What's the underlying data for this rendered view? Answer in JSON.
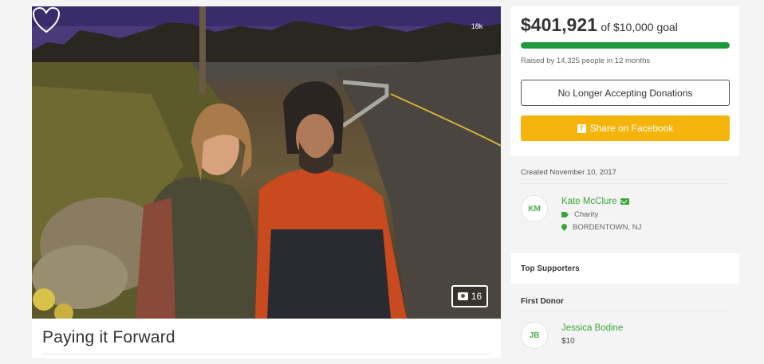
{
  "campaign": {
    "title": "Paying it Forward",
    "heart_count": "18k",
    "photo_count": "16",
    "photo_icon": "camera-icon",
    "heart_icon": "heart-icon"
  },
  "goal": {
    "raised": "$401,921",
    "of_goal": "of $10,000 goal",
    "progress_fraction": 1.0,
    "raised_by": "Raised by 14,325 people in 12 months",
    "progress_color": "#1d9a3e"
  },
  "actions": {
    "no_donations_label": "No Longer Accepting Donations",
    "share_label": "Share on Facebook",
    "share_color": "#f5b40c"
  },
  "organizer": {
    "created": "Created November 10, 2017",
    "initials": "KM",
    "name": "Kate McClure",
    "category": "Charity",
    "location": "BORDENTOWN, NJ"
  },
  "supporters": {
    "top_label": "Top Supporters",
    "first_label": "First Donor",
    "first_donor": {
      "initials": "JB",
      "name": "Jessica Bodine",
      "amount": "$10"
    }
  }
}
